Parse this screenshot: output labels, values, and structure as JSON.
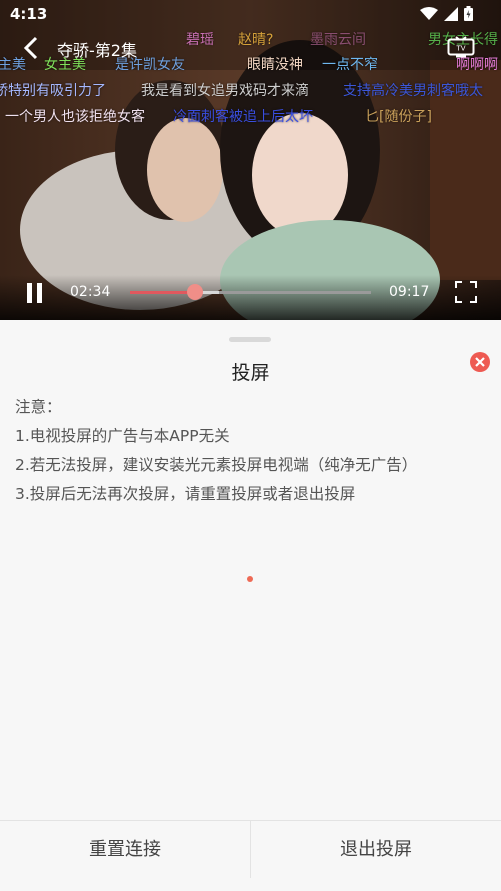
{
  "status_bar": {
    "time": "4:13"
  },
  "video": {
    "title": "夺骄-第2集",
    "current_time": "02:34",
    "total_time": "09:17",
    "played_fraction": 0.27,
    "buffered_fraction": 0.37,
    "danmaku": [
      "碧瑶",
      "赵晴?",
      "墨雨云间",
      "男女主长得",
      "主美",
      "女主美",
      "是许凯女友",
      "眼睛没神",
      "一点不窄",
      "啊啊啊",
      "骄特别有吸引力了",
      "我是看到女追男戏码才来滴",
      "支持高冷美男刺客哦太",
      "一个男人也该拒绝女客",
      "冷面刺客被追上后太坏",
      "匕[随份子]"
    ]
  },
  "cast_sheet": {
    "title": "投屏",
    "notes": [
      "注意：",
      "1.电视投屏的广告与本APP无关",
      "2.若无法投屏，建议安装光元素投屏电视端（纯净无广告）",
      "3.投屏后无法再次投屏，请重置投屏或者退出投屏"
    ],
    "reset_label": "重置连接",
    "exit_label": "退出投屏"
  },
  "colors": {
    "accent": "#ee5a52",
    "progress": "#e1585e"
  }
}
